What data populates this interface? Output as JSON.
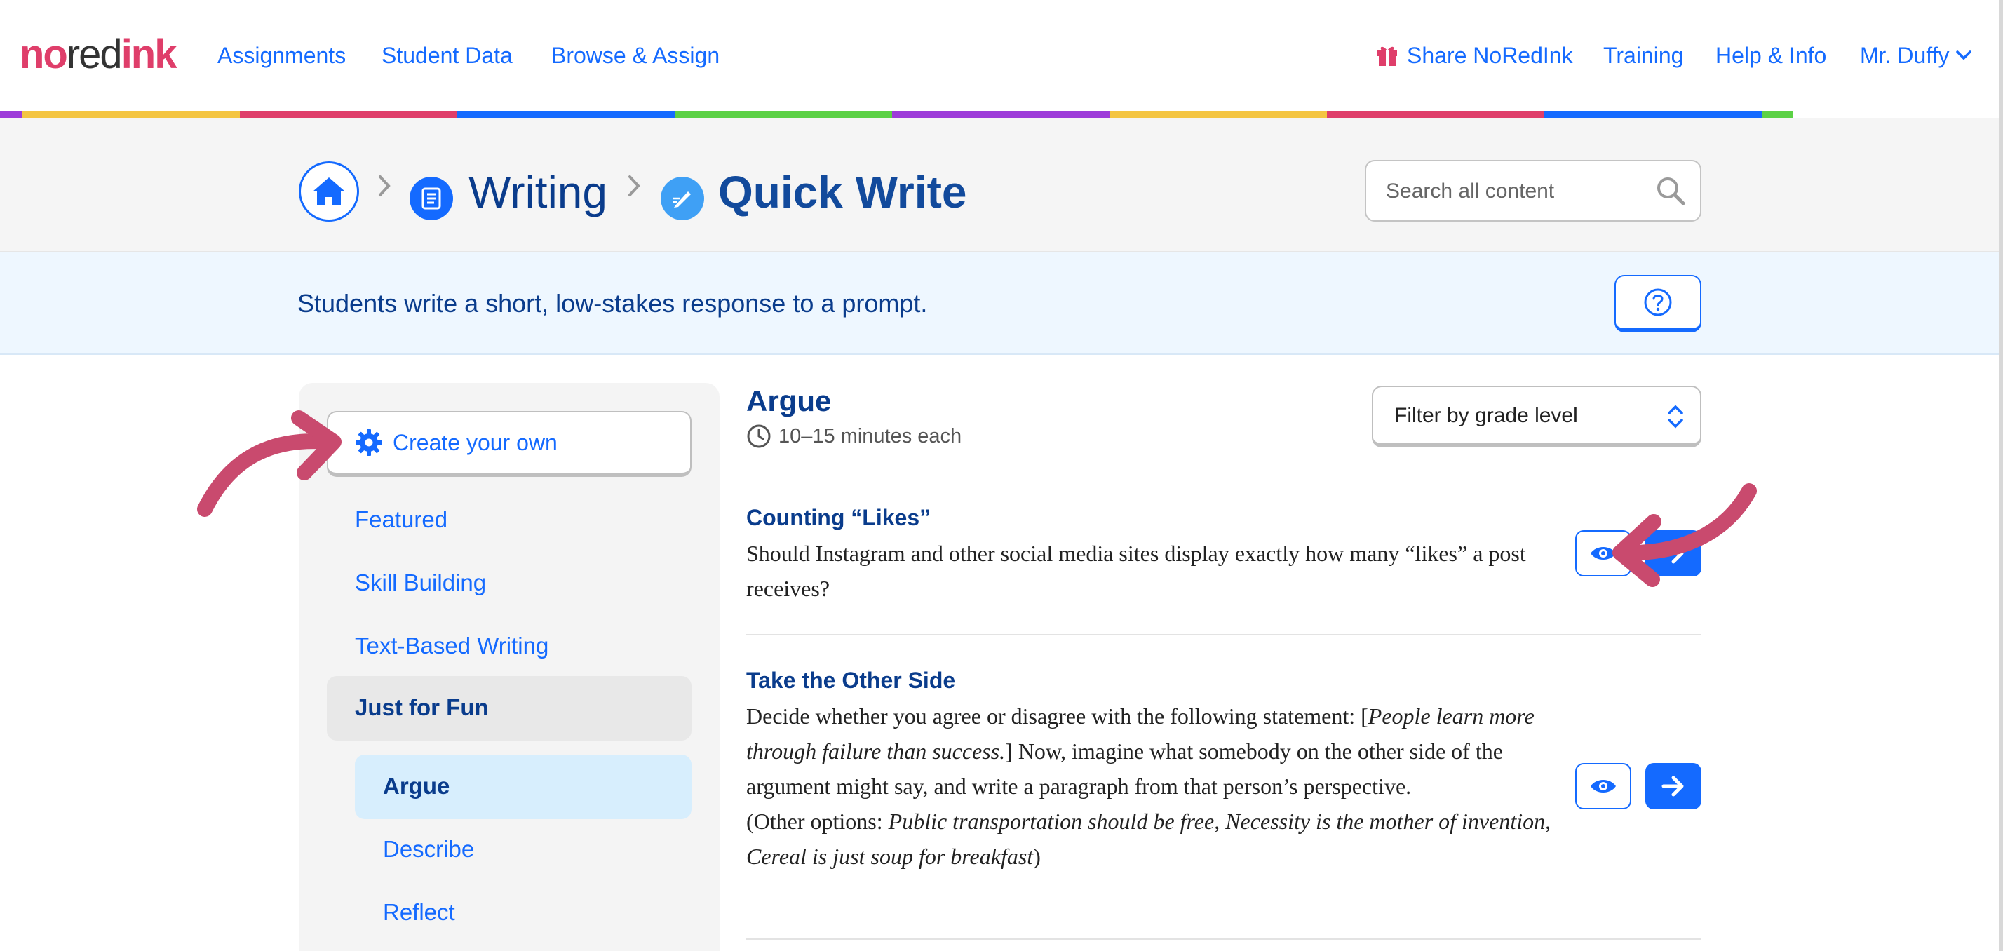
{
  "nav": {
    "logo": {
      "no": "no",
      "red": "red",
      "ink": "ink"
    },
    "assignments": "Assignments",
    "student_data": "Student Data",
    "browse_assign": "Browse & Assign",
    "share": "Share NoRedInk",
    "training": "Training",
    "help": "Help & Info",
    "user": "Mr. Duffy"
  },
  "stripe_colors": [
    "#f4c542",
    "#df3e6a",
    "#146aff",
    "#5bd145",
    "#9d3bd9",
    "#f4c542",
    "#df3e6a",
    "#146aff",
    "#5bd145"
  ],
  "breadcrumb": {
    "writing": "Writing",
    "quick_write": "Quick Write"
  },
  "search": {
    "placeholder": "Search all content"
  },
  "description": "Students write a short, low-stakes response to a prompt.",
  "sidebar": {
    "create": "Create your own",
    "featured": "Featured",
    "skill_building": "Skill Building",
    "text_based": "Text-Based Writing",
    "just_for_fun": "Just for Fun",
    "argue": "Argue",
    "describe": "Describe",
    "reflect": "Reflect"
  },
  "section": {
    "title": "Argue",
    "time": "10–15 minutes each",
    "filter": "Filter by grade level"
  },
  "prompts": [
    {
      "title": "Counting “Likes”",
      "body": "Should Instagram and other social media sites display exactly how many “likes” a post receives?"
    },
    {
      "title": "Take the Other Side",
      "body_1": "Decide whether you agree or disagree with the following statement: [",
      "body_2": "People learn more through failure than success.",
      "body_3": "] Now, imagine what somebody on the other side of the argument might say, and write a paragraph from that person’s perspective.",
      "body_4": "(Other options: ",
      "body_5": "Public transportation should be free",
      "body_6": ", ",
      "body_7": "Necessity is the mother of invention",
      "body_8": ", ",
      "body_9": "Cereal is just soup for breakfast",
      "body_10": ")"
    }
  ],
  "colors": {
    "primary_blue": "#146aff",
    "navy": "#0a3c8c",
    "brand_pink": "#df3e6a",
    "annotation_arrow": "#c94a6e"
  }
}
